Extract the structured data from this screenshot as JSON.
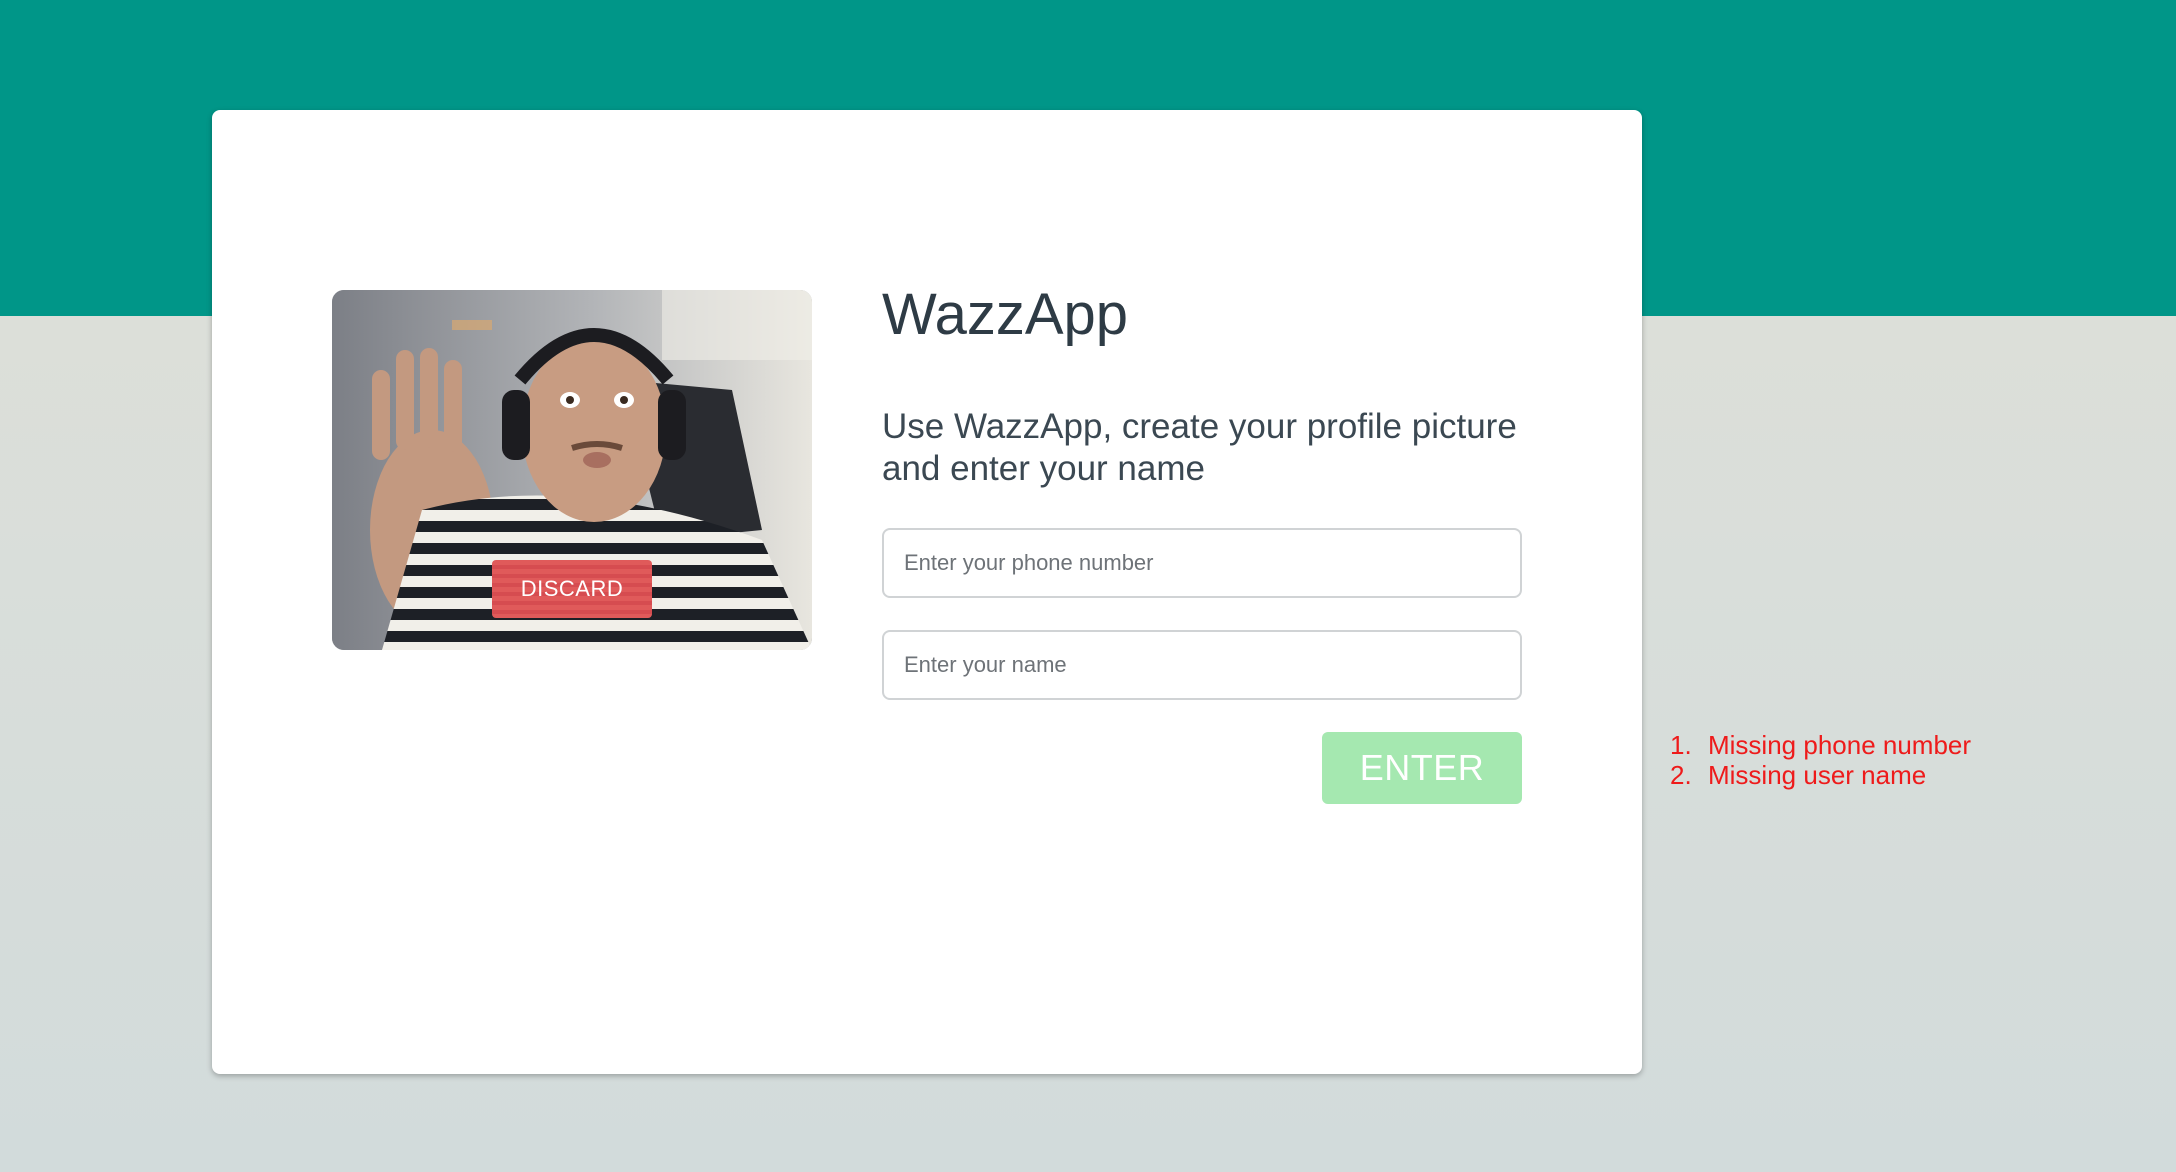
{
  "app": {
    "title": "WazzApp",
    "subtitle": "Use WazzApp, create your profile picture and enter your name"
  },
  "photo": {
    "discard_label": "DISCARD"
  },
  "form": {
    "phone_placeholder": "Enter your phone number",
    "phone_value": "",
    "name_placeholder": "Enter your name",
    "name_value": "",
    "enter_label": "ENTER"
  },
  "errors": {
    "items": [
      {
        "number": "1.",
        "text": "Missing phone number"
      },
      {
        "number": "2.",
        "text": "Missing user name"
      }
    ]
  },
  "colors": {
    "header_band": "#009688",
    "background": "#d6dbd8",
    "discard_button": "#e05a5a",
    "enter_button_disabled": "#a5e8b0",
    "error_text": "#ee1b1b",
    "title_text": "#2e3b45"
  }
}
